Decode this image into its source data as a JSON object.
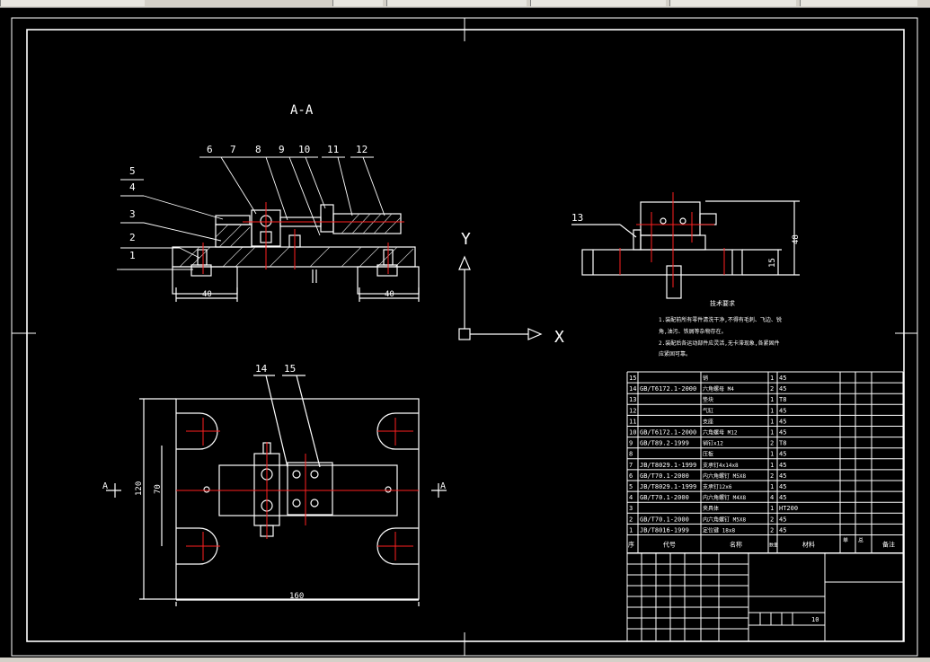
{
  "section_label": "A-A",
  "balloons": [
    "1",
    "2",
    "3",
    "4",
    "5",
    "6",
    "7",
    "8",
    "9",
    "10",
    "11",
    "12",
    "13",
    "14",
    "15"
  ],
  "dims": {
    "left_width": "40",
    "right_width": "40",
    "side_height": "48",
    "side_base": "15",
    "plan_width": "160",
    "plan_height": "120",
    "plan_inner_height": "70"
  },
  "section_marks": {
    "left": "A",
    "right": "A"
  },
  "axes": {
    "y": "Y",
    "x": "X"
  },
  "bom": [
    {
      "no": "15",
      "std": "",
      "name": "销",
      "qty": "1",
      "mat": "45"
    },
    {
      "no": "14",
      "std": "GB/T6172.1-2000",
      "name": "六角螺母 M4",
      "qty": "2",
      "mat": "45"
    },
    {
      "no": "13",
      "std": "",
      "name": "垫块",
      "qty": "1",
      "mat": "T8"
    },
    {
      "no": "12",
      "std": "",
      "name": "气缸",
      "qty": "1",
      "mat": "45"
    },
    {
      "no": "11",
      "std": "",
      "name": "支座",
      "qty": "1",
      "mat": "45"
    },
    {
      "no": "10",
      "std": "GB/T6172.1-2000",
      "name": "六角螺母 M12",
      "qty": "1",
      "mat": "45"
    },
    {
      "no": "9",
      "std": "GB/T89.2-1999",
      "name": "销钉x12",
      "qty": "2",
      "mat": "T8"
    },
    {
      "no": "8",
      "std": "",
      "name": "压板",
      "qty": "1",
      "mat": "45"
    },
    {
      "no": "7",
      "std": "JB/T8029.1-1999",
      "name": "支承钉4x14x8",
      "qty": "1",
      "mat": "45"
    },
    {
      "no": "6",
      "std": "GB/T70.1-2000",
      "name": "内六角螺钉 M5X8",
      "qty": "2",
      "mat": "45"
    },
    {
      "no": "5",
      "std": "JB/T8029.1-1999",
      "name": "支承钉12x6",
      "qty": "1",
      "mat": "45"
    },
    {
      "no": "4",
      "std": "GB/T70.1-2000",
      "name": "内六角螺钉 M4X8",
      "qty": "4",
      "mat": "45"
    },
    {
      "no": "3",
      "std": "",
      "name": "夹具体",
      "qty": "1",
      "mat": "HT200"
    },
    {
      "no": "2",
      "std": "GB/T70.1-2000",
      "name": "内六角螺钉 M5X8",
      "qty": "2",
      "mat": "45"
    },
    {
      "no": "1",
      "std": "JB/T8016-1999",
      "name": "定位键 18x8",
      "qty": "2",
      "mat": "45"
    }
  ],
  "bom_header": {
    "no": "序",
    "std": "代号",
    "name": "名称",
    "qty": "数量",
    "mat": "材料",
    "wt1": "单",
    "wt2": "总",
    "note": "备注"
  },
  "title_block": {
    "scale_value": "10"
  },
  "tech_req": {
    "title": "技术要求",
    "line1": "1.装配前所有零件清洗干净,不得有毛刺、飞边、锐",
    "line2": "角,油污、铁屑等杂物存在。",
    "line3": "2.装配后各运动部件应灵活,无卡滞现象,各紧固件",
    "line4": "应紧固可靠。"
  },
  "colors": {
    "line": "#ffffff",
    "center": "#ff2020",
    "leader": "#ffffff",
    "hatch": "#d8d8d8",
    "frame": "#ffffff"
  }
}
